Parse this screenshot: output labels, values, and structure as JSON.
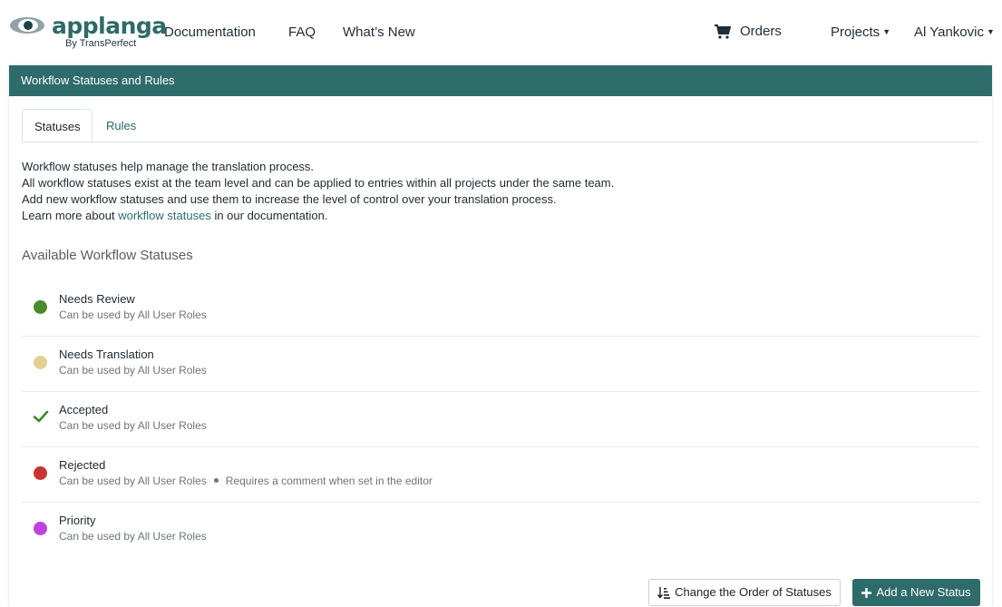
{
  "nav": {
    "logo_word": "applanga",
    "logo_sub": "By TransPerfect",
    "documentation": "Documentation",
    "faq": "FAQ",
    "whats_new": "What’s New",
    "orders": "Orders",
    "projects": "Projects",
    "user": "Al Yankovic"
  },
  "panel": {
    "title": "Workflow Statuses and Rules",
    "tabs": [
      {
        "label": "Statuses"
      },
      {
        "label": "Rules"
      }
    ],
    "intro": {
      "line1": "Workflow statuses help manage the translation process.",
      "line2": "All workflow statuses exist at the team level and can be applied to entries within all projects under the same team.",
      "line3": "Add new workflow statuses and use them to increase the level of control over your translation process.",
      "line4_prefix": "Learn more about ",
      "line4_link": "workflow statuses",
      "line4_suffix": " in our documentation."
    },
    "section_title": "Available Workflow Statuses",
    "statuses": [
      {
        "name": "Needs Review",
        "roles": "Can be used by All User Roles",
        "icon": "dot",
        "color": "#4b8a2a"
      },
      {
        "name": "Needs Translation",
        "roles": "Can be used by All User Roles",
        "icon": "dot",
        "color": "#e3d092"
      },
      {
        "name": "Accepted",
        "roles": "Can be used by All User Roles",
        "icon": "check",
        "color": "#3f8a2a"
      },
      {
        "name": "Rejected",
        "roles": "Can be used by All User Roles",
        "note": "Requires a comment when set in the editor",
        "icon": "dot",
        "color": "#cc3333"
      },
      {
        "name": "Priority",
        "roles": "Can be used by All User Roles",
        "icon": "dot",
        "color": "#c040e0"
      }
    ],
    "buttons": {
      "change_order": "Change the Order of Statuses",
      "add_status": "Add a New Status"
    }
  }
}
